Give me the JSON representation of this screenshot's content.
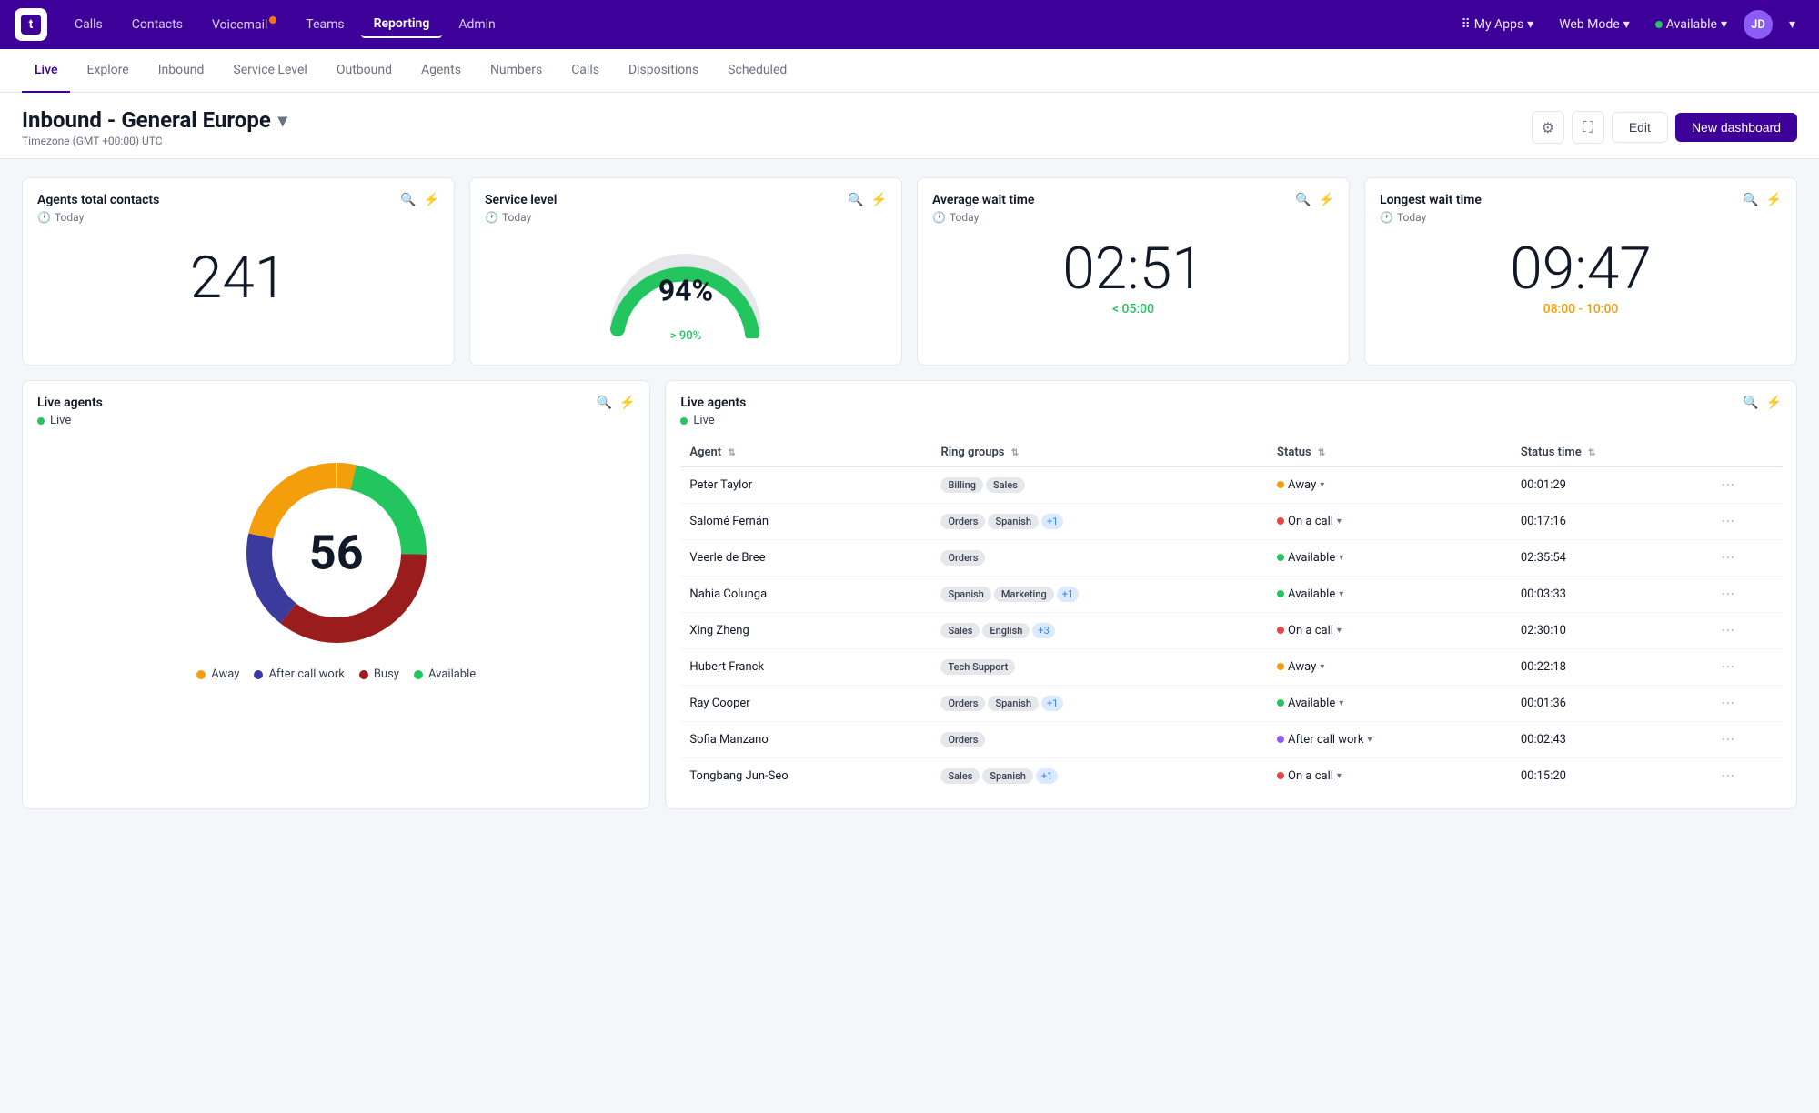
{
  "app": {
    "logo_text": "t"
  },
  "top_nav": {
    "items": [
      {
        "label": "Calls",
        "active": false
      },
      {
        "label": "Contacts",
        "active": false
      },
      {
        "label": "Voicemail",
        "active": false,
        "has_dot": true
      },
      {
        "label": "Teams",
        "active": false
      },
      {
        "label": "Reporting",
        "active": true
      },
      {
        "label": "Admin",
        "active": false
      }
    ],
    "right_items": [
      {
        "label": "My Apps",
        "has_chevron": true
      },
      {
        "label": "Web Mode",
        "has_chevron": true
      },
      {
        "label": "Available",
        "has_dot": true,
        "has_chevron": true
      }
    ],
    "avatar_initials": "JD"
  },
  "sub_nav": {
    "items": [
      {
        "label": "Live",
        "active": true
      },
      {
        "label": "Explore",
        "active": false
      },
      {
        "label": "Inbound",
        "active": false
      },
      {
        "label": "Service Level",
        "active": false
      },
      {
        "label": "Outbound",
        "active": false
      },
      {
        "label": "Agents",
        "active": false
      },
      {
        "label": "Numbers",
        "active": false
      },
      {
        "label": "Calls",
        "active": false
      },
      {
        "label": "Dispositions",
        "active": false
      },
      {
        "label": "Scheduled",
        "active": false
      }
    ]
  },
  "page_header": {
    "title": "Inbound - General Europe",
    "subtitle": "Timezone (GMT +00:00) UTC",
    "edit_label": "Edit",
    "new_dashboard_label": "New dashboard"
  },
  "widgets": {
    "agents_total": {
      "title": "Agents total contacts",
      "time_label": "Today",
      "value": "241"
    },
    "service_level": {
      "title": "Service level",
      "time_label": "Today",
      "percent": "94%",
      "target": "> 90%",
      "gauge_value": 94
    },
    "avg_wait": {
      "title": "Average wait time",
      "time_label": "Today",
      "value": "02:51",
      "threshold": "< 05:00",
      "threshold_color": "green"
    },
    "longest_wait": {
      "title": "Longest wait time",
      "time_label": "Today",
      "value": "09:47",
      "threshold": "08:00 - 10:00",
      "threshold_color": "yellow"
    }
  },
  "live_agents_chart": {
    "title": "Live agents",
    "live_label": "Live",
    "total": "56",
    "segments": [
      {
        "label": "Away",
        "color": "#f59e0b",
        "value": 12,
        "degrees": 77
      },
      {
        "label": "After call work",
        "color": "#3b3b9e",
        "value": 10,
        "degrees": 64
      },
      {
        "label": "Busy",
        "color": "#9b1c1c",
        "value": 20,
        "degrees": 128
      },
      {
        "label": "Available",
        "color": "#22c55e",
        "value": 14,
        "degrees": 90
      }
    ]
  },
  "live_agents_table": {
    "title": "Live agents",
    "live_label": "Live",
    "columns": [
      {
        "label": "Agent",
        "sort": true
      },
      {
        "label": "Ring groups",
        "sort": true
      },
      {
        "label": "Status",
        "sort": true
      },
      {
        "label": "Status time",
        "sort": true
      }
    ],
    "rows": [
      {
        "agent": "Peter Taylor",
        "ring_groups": [
          "Billing",
          "Sales"
        ],
        "ring_groups_extra": null,
        "status": "Away",
        "status_type": "yellow",
        "status_time": "00:01:29"
      },
      {
        "agent": "Salomé Fernán",
        "ring_groups": [
          "Orders",
          "Spanish"
        ],
        "ring_groups_extra": "+1",
        "status": "On a call",
        "status_type": "red",
        "status_time": "00:17:16"
      },
      {
        "agent": "Veerle de Bree",
        "ring_groups": [
          "Orders"
        ],
        "ring_groups_extra": null,
        "status": "Available",
        "status_type": "green",
        "status_time": "02:35:54"
      },
      {
        "agent": "Nahia Colunga",
        "ring_groups": [
          "Spanish",
          "Marketing"
        ],
        "ring_groups_extra": "+1",
        "status": "Available",
        "status_type": "green",
        "status_time": "00:03:33"
      },
      {
        "agent": "Xing Zheng",
        "ring_groups": [
          "Sales",
          "English"
        ],
        "ring_groups_extra": "+3",
        "status": "On a call",
        "status_type": "red",
        "status_time": "02:30:10"
      },
      {
        "agent": "Hubert Franck",
        "ring_groups": [
          "Tech Support"
        ],
        "ring_groups_extra": null,
        "status": "Away",
        "status_type": "yellow",
        "status_time": "00:22:18"
      },
      {
        "agent": "Ray Cooper",
        "ring_groups": [
          "Orders",
          "Spanish"
        ],
        "ring_groups_extra": "+1",
        "status": "Available",
        "status_type": "green",
        "status_time": "00:01:36"
      },
      {
        "agent": "Sofia Manzano",
        "ring_groups": [
          "Orders"
        ],
        "ring_groups_extra": null,
        "status": "After call work",
        "status_type": "purple",
        "status_time": "00:02:43"
      },
      {
        "agent": "Tongbang Jun-Seo",
        "ring_groups": [
          "Sales",
          "Spanish"
        ],
        "ring_groups_extra": "+1",
        "status": "On a call",
        "status_type": "red",
        "status_time": "00:15:20"
      }
    ]
  }
}
